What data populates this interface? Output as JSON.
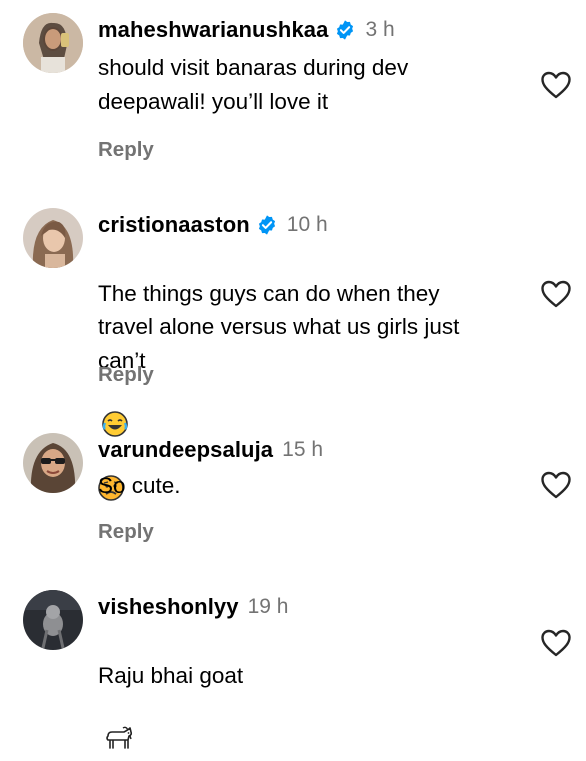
{
  "comments": [
    {
      "username": "maheshwarianushkaa",
      "verified": true,
      "time": "3 h",
      "text": "should visit banaras during dev\ndeepawali! you’ll love it",
      "reply_label": "Reply"
    },
    {
      "username": "cristionaaston",
      "verified": true,
      "time": "10 h",
      "text": "The things guys can do when they\ntravel alone versus what us girls just\ncan’t",
      "emojis": [
        "face-with-tears-of-joy",
        "sad-face"
      ],
      "reply_label": "Reply"
    },
    {
      "username": "varundeepsaluja",
      "verified": false,
      "time": "15 h",
      "text": "So cute.",
      "reply_label": "Reply"
    },
    {
      "username": "visheshonlyy",
      "verified": false,
      "time": "19 h",
      "text": "Raju bhai goat",
      "emojis": [
        "goat"
      ]
    }
  ],
  "icons": {
    "verified": "verified-badge-icon",
    "like": "heart-outline-icon"
  },
  "colors": {
    "verified_badge": "#0095F6",
    "secondary_text": "#737373"
  }
}
